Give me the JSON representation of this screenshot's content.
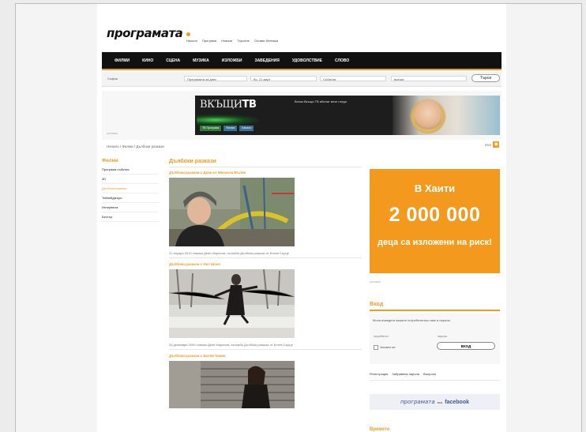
{
  "header": {
    "logo": "програмата",
    "toplinks": [
      "Начало",
      "Програма",
      "Новини",
      "Търсене",
      "Остави бележка"
    ]
  },
  "nav": {
    "items": [
      "Филми",
      "Кино",
      "Сцена",
      "Музика",
      "Изложби",
      "Заведения",
      "Удоволствие",
      "Слово"
    ]
  },
  "filters": {
    "city": "София",
    "program": "Програмата за днес",
    "date": "Вс, 21 март",
    "sort": "Събития",
    "genre": "всички",
    "search_label": "Търси"
  },
  "banner": {
    "logo_a": "ВКЪЩИ",
    "logo_b": "ТВ",
    "text": "Всеки Вкъщи ТВ абонат вече гледа",
    "buttons": [
      "ТВ Програма",
      "Филми",
      "Канали"
    ],
    "label": "реклама"
  },
  "breadcrumb": "Начало / Филми / Дълбоки разкази",
  "rss_label": "RSS",
  "sidebar": {
    "title": "Филми",
    "items": [
      {
        "label": "Програма събития",
        "active": false
      },
      {
        "label": "3D",
        "active": false
      },
      {
        "label": "Дълбоки разкази",
        "active": true
      },
      {
        "label": "Тийнейджъри",
        "active": false
      },
      {
        "label": "Интервюта",
        "active": false
      },
      {
        "label": "Бестър",
        "active": false
      }
    ]
  },
  "main": {
    "title": "Дълбоки разкази",
    "articles": [
      {
        "title": "Дълбоки разкази с Деян от Михаела Вълев",
        "caption": "21 януари 2010 снимка Деян Маринов, изложба Дълбоки разкази от Ботев Сърце"
      },
      {
        "title": "Дълбоки разкази с Нат Шонс",
        "caption": "25 декември 2009 снимка Деян Маринов, изложба Дълбоки разкази от Ботев Сърце"
      },
      {
        "title": "Дълбоки разкази с Ботев Човек",
        "caption": ""
      }
    ]
  },
  "ad": {
    "line1": "В Хаити",
    "number": "2 000 000",
    "line3": "деца са изложени на риск!",
    "label": "реклама"
  },
  "login": {
    "title": "Вход",
    "hint": "Моля въведете вашите потребителско име и парола.",
    "user_label": "потребител",
    "pass_label": "парола",
    "remember": "Запомни ме",
    "button": "ВХОД",
    "links": [
      "Регистрация",
      "Забравена парола",
      "Въпроси"
    ]
  },
  "facebook": {
    "prog": "програмата",
    "in": "във",
    "fb": "facebook"
  },
  "weather_title": "Времето",
  "colors": {
    "accent": "#f39a1e",
    "nav": "#111111"
  }
}
